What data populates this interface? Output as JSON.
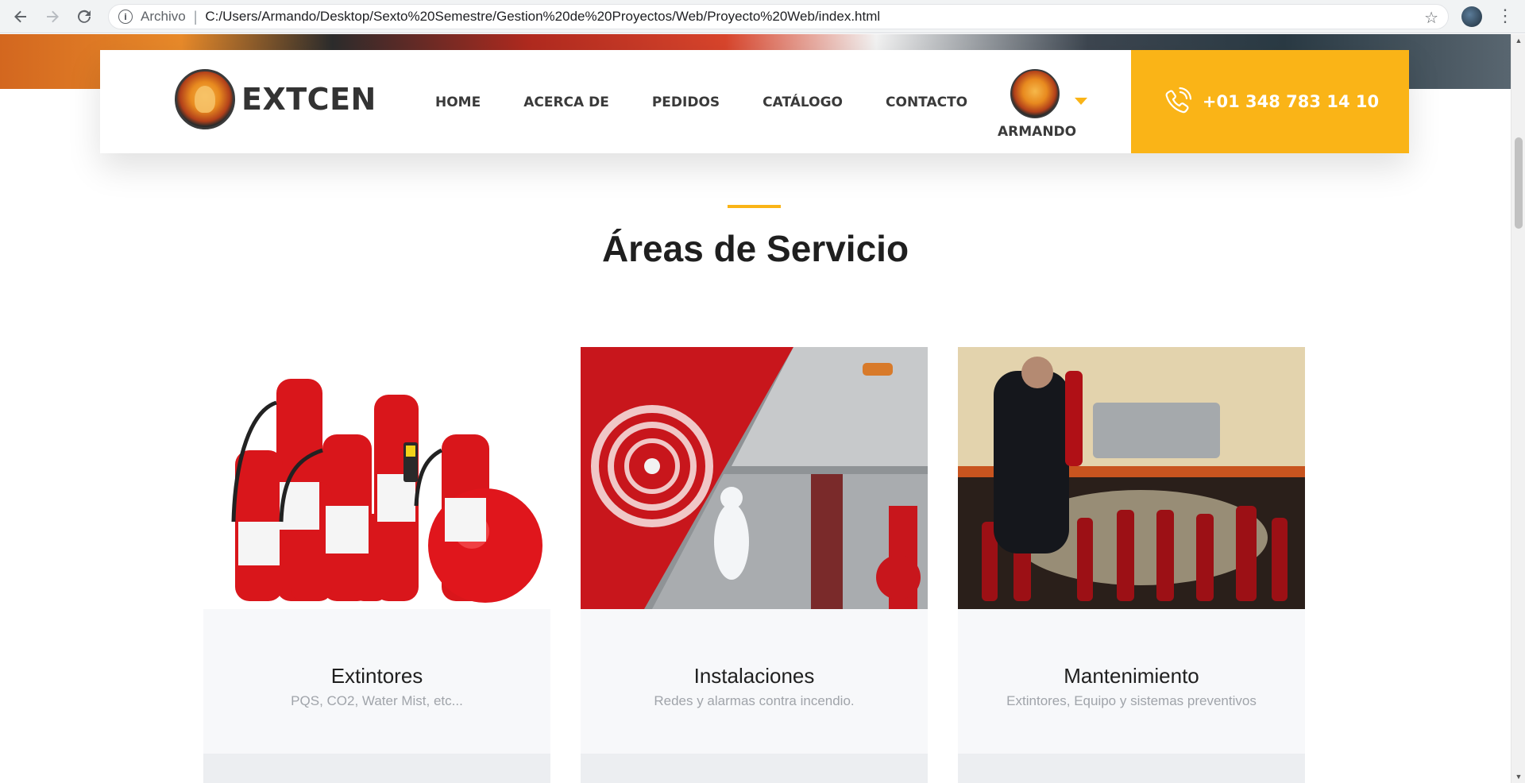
{
  "browser": {
    "scheme_label": "Archivo",
    "url": "C:/Users/Armando/Desktop/Sexto%20Semestre/Gestion%20de%20Proyectos/Web/Proyecto%20Web/index.html"
  },
  "header": {
    "brand": "EXTCEN",
    "nav": [
      "HOME",
      "ACERCA DE",
      "PEDIDOS",
      "CATÁLOGO",
      "CONTACTO"
    ],
    "user_name": "ARMANDO",
    "phone": "+01 348 783 14 10"
  },
  "section": {
    "title": "Áreas de Servicio"
  },
  "cards": [
    {
      "title": "Extintores",
      "subtitle": "PQS, CO2, Water Mist, etc..."
    },
    {
      "title": "Instalaciones",
      "subtitle": "Redes y alarmas contra incendio."
    },
    {
      "title": "Mantenimiento",
      "subtitle": "Extintores, Equipo y sistemas preventivos"
    }
  ],
  "colors": {
    "accent": "#fab417",
    "text_dark": "#1f1f1f",
    "text_muted": "#a0a4aa",
    "card_bg": "#f7f8fa"
  },
  "icons": [
    "back-icon",
    "forward-icon",
    "reload-icon",
    "info-icon",
    "star-icon",
    "profile-icon",
    "menu-icon",
    "phone-icon",
    "chevron-down-icon"
  ]
}
